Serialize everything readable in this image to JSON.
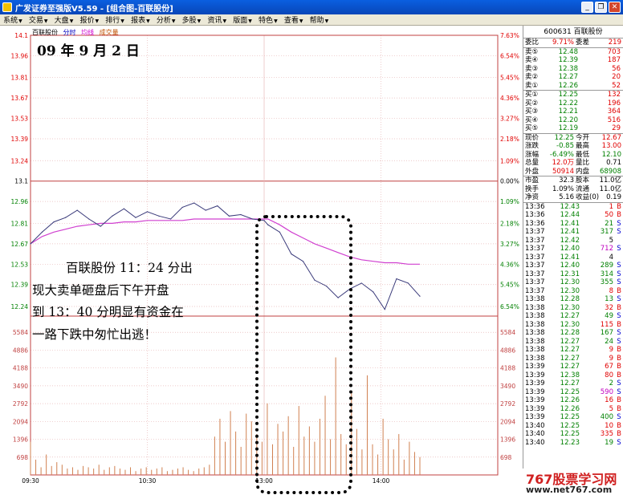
{
  "window": {
    "title": "广发证券至强版V5.59 - [组合图-百联股份]"
  },
  "menu": [
    "系统",
    "交易",
    "大盘",
    "报价",
    "排行",
    "报表",
    "分析",
    "多股",
    "资讯",
    "版面",
    "特色",
    "查看",
    "帮助"
  ],
  "legend": {
    "name": "百联股份",
    "t": "分时",
    "avg": "均线",
    "vol": "成交量"
  },
  "date_label": "09 年 9 月 2 日",
  "annotation": {
    "line1": "百联股份 11：24 分出",
    "line2": "现大卖单砸盘后下午开盘",
    "line3": "到 13：40 分明显有资金在",
    "line4": "一路下跌中匆忙出逃！"
  },
  "colors": {
    "up": "#e00000",
    "down": "#008000",
    "price_line": "#3a3a7a",
    "avg_line": "#d040d0",
    "volume": "#d08050"
  },
  "chart_data": {
    "type": "line",
    "prev_close": 13.1,
    "y_ticks": [
      14.1,
      13.96,
      13.81,
      13.67,
      13.53,
      13.39,
      13.24,
      13.1,
      12.96,
      12.81,
      12.67,
      12.53,
      12.39,
      12.24
    ],
    "pct_ticks": [
      "7.63%",
      "6.54%",
      "5.45%",
      "4.36%",
      "3.27%",
      "2.18%",
      "1.09%",
      "0.00%",
      "1.09%",
      "2.18%",
      "3.27%",
      "4.36%",
      "5.45%",
      "6.54%"
    ],
    "vol_ticks": [
      5584,
      4886,
      4188,
      3490,
      2792,
      2094,
      1396,
      698
    ],
    "x_ticks": [
      "09:30",
      "10:30",
      "13:00",
      "14:00"
    ],
    "x": [
      0,
      6,
      12,
      18,
      24,
      30,
      36,
      42,
      48,
      54,
      60,
      66,
      72,
      78,
      84,
      90,
      96,
      102,
      108,
      114,
      120,
      122,
      128,
      134,
      140,
      146,
      152,
      158,
      164,
      170,
      176,
      182,
      188,
      194,
      200
    ],
    "price": [
      12.67,
      12.75,
      12.82,
      12.85,
      12.9,
      12.84,
      12.79,
      12.86,
      12.91,
      12.85,
      12.89,
      12.86,
      12.84,
      12.92,
      12.95,
      12.9,
      12.93,
      12.86,
      12.87,
      12.84,
      12.83,
      12.8,
      12.75,
      12.6,
      12.55,
      12.42,
      12.38,
      12.3,
      12.36,
      12.4,
      12.34,
      12.22,
      12.43,
      12.4,
      12.31
    ],
    "avg": [
      12.67,
      12.72,
      12.75,
      12.77,
      12.79,
      12.8,
      12.81,
      12.81,
      12.82,
      12.82,
      12.83,
      12.83,
      12.83,
      12.83,
      12.84,
      12.84,
      12.84,
      12.84,
      12.84,
      12.84,
      12.84,
      12.84,
      12.8,
      12.75,
      12.71,
      12.67,
      12.64,
      12.61,
      12.58,
      12.56,
      12.55,
      12.54,
      12.54,
      12.53,
      12.53
    ],
    "volume": [
      1300,
      600,
      300,
      800,
      350,
      500,
      400,
      250,
      300,
      200,
      350,
      300,
      250,
      400,
      200,
      300,
      350,
      250,
      200,
      300,
      150,
      250,
      300,
      200,
      250,
      300,
      150,
      200,
      250,
      300,
      200,
      150,
      250,
      300,
      400,
      1500,
      2200,
      1300,
      2500,
      1700,
      1100,
      2400,
      2100,
      1600,
      1300,
      2800,
      1200,
      2000,
      1700,
      2300,
      1100,
      2700,
      1500,
      1900,
      1300,
      2200,
      3100,
      1400,
      4600,
      1600,
      1200,
      3300,
      1800,
      1000,
      3900,
      1200,
      800,
      2200,
      1400,
      1000,
      1600,
      600,
      1300,
      900,
      700
    ]
  },
  "panel": {
    "code": "600631",
    "name": "百联股份",
    "ratio": {
      "k1": "委比",
      "v1": "9.71%",
      "k2": "委差",
      "v2": "219"
    },
    "asks": [
      {
        "label": "卖⑤",
        "price": "12.48",
        "qty": "703"
      },
      {
        "label": "卖④",
        "price": "12.39",
        "qty": "187"
      },
      {
        "label": "卖③",
        "price": "12.38",
        "qty": "56"
      },
      {
        "label": "卖②",
        "price": "12.27",
        "qty": "20"
      },
      {
        "label": "卖①",
        "price": "12.26",
        "qty": "52"
      }
    ],
    "bids": [
      {
        "label": "买①",
        "price": "12.25",
        "qty": "132"
      },
      {
        "label": "买②",
        "price": "12.22",
        "qty": "196"
      },
      {
        "label": "买③",
        "price": "12.21",
        "qty": "364"
      },
      {
        "label": "买④",
        "price": "12.20",
        "qty": "516"
      },
      {
        "label": "买⑤",
        "price": "12.19",
        "qty": "29"
      }
    ],
    "quote1": [
      {
        "k1": "现价",
        "v1": "12.25",
        "k2": "今开",
        "v2": "12.67"
      },
      {
        "k1": "涨跌",
        "v1": "-0.85",
        "k2": "最高",
        "v2": "13.00"
      },
      {
        "k1": "涨幅",
        "v1": "-6.49%",
        "k2": "最低",
        "v2": "12.10"
      },
      {
        "k1": "总量",
        "v1": "12.0万",
        "k2": "量比",
        "v2": "0.71"
      },
      {
        "k1": "外盘",
        "v1": "50914",
        "k2": "内盘",
        "v2": "68908"
      }
    ],
    "quote2": [
      {
        "k1": "市盈",
        "v1": "32.3",
        "k2": "股本",
        "v2": "11.0亿"
      },
      {
        "k1": "换手",
        "v1": "1.09%",
        "k2": "流通",
        "v2": "11.0亿"
      },
      {
        "k1": "净资",
        "v1": "5.16",
        "k2": "收益(0)",
        "v2": "0.19"
      }
    ],
    "ticks": [
      {
        "t": "13:36",
        "p": "12.43",
        "v": "1",
        "bs": "B"
      },
      {
        "t": "13:36",
        "p": "12.44",
        "v": "50",
        "bs": "B"
      },
      {
        "t": "13:36",
        "p": "12.41",
        "v": "21",
        "bs": "S"
      },
      {
        "t": "13:37",
        "p": "12.41",
        "v": "317",
        "bs": "S"
      },
      {
        "t": "13:37",
        "p": "12.42",
        "v": "5",
        "bs": ""
      },
      {
        "t": "13:37",
        "p": "12.40",
        "v": "712",
        "bs": "S"
      },
      {
        "t": "13:37",
        "p": "12.41",
        "v": "4",
        "bs": ""
      },
      {
        "t": "13:37",
        "p": "12.40",
        "v": "289",
        "bs": "S"
      },
      {
        "t": "13:37",
        "p": "12.31",
        "v": "314",
        "bs": "S"
      },
      {
        "t": "13:37",
        "p": "12.30",
        "v": "355",
        "bs": "S"
      },
      {
        "t": "13:37",
        "p": "12.30",
        "v": "8",
        "bs": "B"
      },
      {
        "t": "13:38",
        "p": "12.28",
        "v": "13",
        "bs": "S"
      },
      {
        "t": "13:38",
        "p": "12.30",
        "v": "32",
        "bs": "B"
      },
      {
        "t": "13:38",
        "p": "12.27",
        "v": "49",
        "bs": "S"
      },
      {
        "t": "13:38",
        "p": "12.30",
        "v": "115",
        "bs": "B"
      },
      {
        "t": "13:38",
        "p": "12.28",
        "v": "167",
        "bs": "S"
      },
      {
        "t": "13:38",
        "p": "12.27",
        "v": "24",
        "bs": "S"
      },
      {
        "t": "13:38",
        "p": "12.27",
        "v": "9",
        "bs": "B"
      },
      {
        "t": "13:38",
        "p": "12.27",
        "v": "9",
        "bs": "B"
      },
      {
        "t": "13:39",
        "p": "12.27",
        "v": "67",
        "bs": "B"
      },
      {
        "t": "13:39",
        "p": "12.38",
        "v": "80",
        "bs": "B"
      },
      {
        "t": "13:39",
        "p": "12.27",
        "v": "2",
        "bs": "S"
      },
      {
        "t": "13:39",
        "p": "12.25",
        "v": "590",
        "bs": "S"
      },
      {
        "t": "13:39",
        "p": "12.26",
        "v": "16",
        "bs": "B"
      },
      {
        "t": "13:39",
        "p": "12.26",
        "v": "5",
        "bs": "B"
      },
      {
        "t": "13:39",
        "p": "12.25",
        "v": "400",
        "bs": "S"
      },
      {
        "t": "13:40",
        "p": "12.25",
        "v": "10",
        "bs": "B"
      },
      {
        "t": "13:40",
        "p": "12.25",
        "v": "335",
        "bs": "B"
      },
      {
        "t": "13:40",
        "p": "12.23",
        "v": "19",
        "bs": "S"
      }
    ]
  },
  "watermark": {
    "line1": "767股票学习网",
    "line2": "www.net767.com"
  }
}
